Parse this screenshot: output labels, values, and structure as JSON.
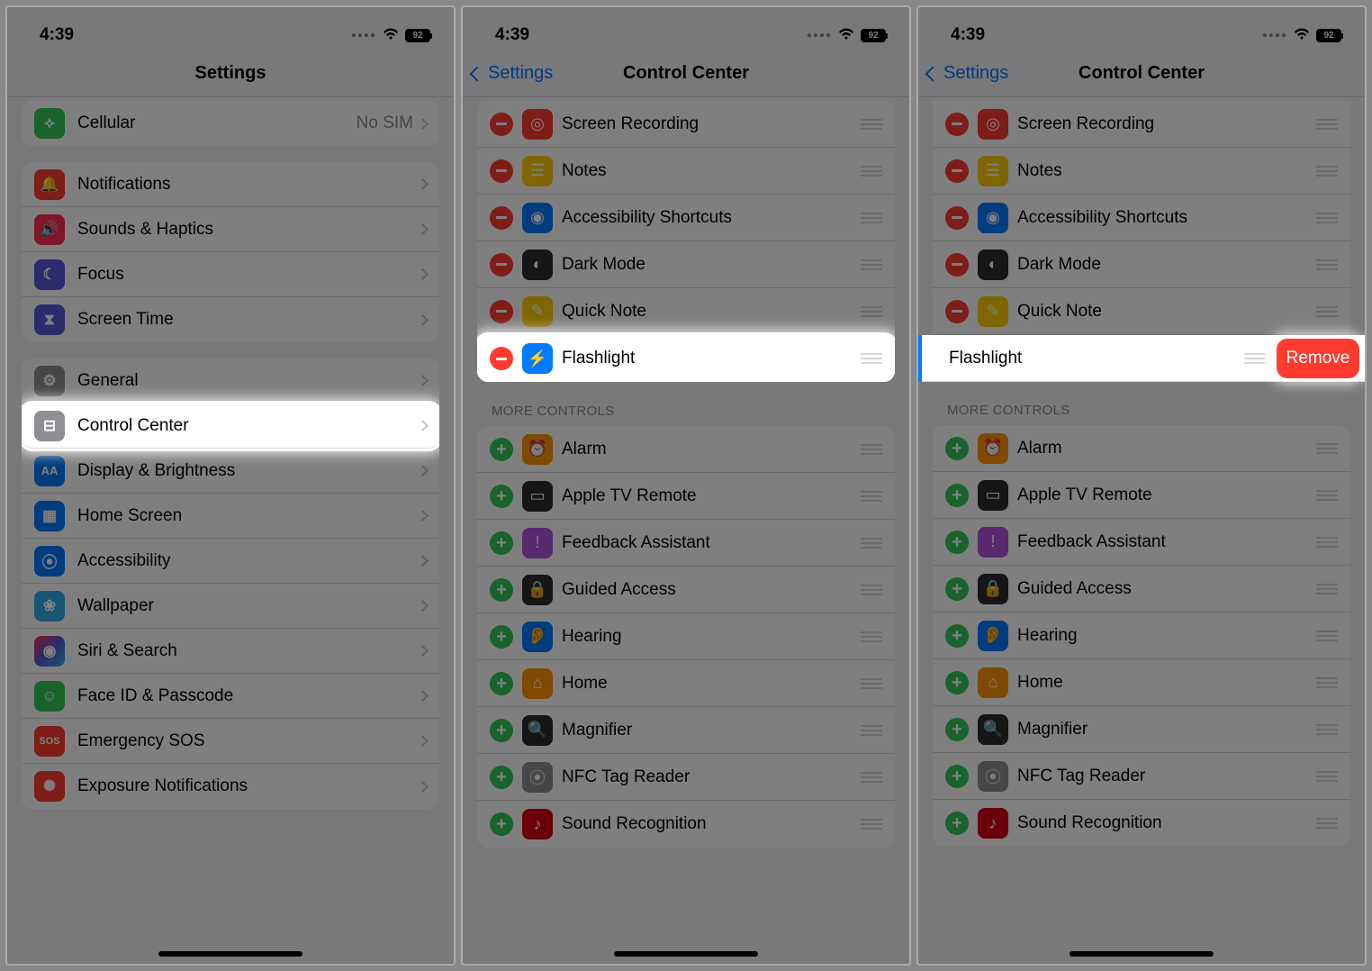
{
  "status": {
    "time": "4:39",
    "battery": "92"
  },
  "screen1": {
    "title": "Settings",
    "cellular": {
      "label": "Cellular",
      "detail": "No SIM"
    },
    "group_notifications": [
      {
        "label": "Notifications",
        "icon": "bell-icon",
        "color": "bg-red"
      },
      {
        "label": "Sounds & Haptics",
        "icon": "speaker-icon",
        "color": "bg-red2"
      },
      {
        "label": "Focus",
        "icon": "moon-icon",
        "color": "bg-indigo"
      },
      {
        "label": "Screen Time",
        "icon": "hourglass-icon",
        "color": "bg-indigo"
      }
    ],
    "group_general": [
      {
        "label": "General",
        "icon": "gear-icon",
        "color": "bg-gray"
      },
      {
        "label": "Control Center",
        "icon": "switches-icon",
        "color": "bg-gray",
        "highlight": true
      },
      {
        "label": "Display & Brightness",
        "icon": "aa-icon",
        "color": "bg-blue"
      },
      {
        "label": "Home Screen",
        "icon": "grid-icon",
        "color": "bg-blue"
      },
      {
        "label": "Accessibility",
        "icon": "person-icon",
        "color": "bg-blue"
      },
      {
        "label": "Wallpaper",
        "icon": "flower-icon",
        "color": "bg-cyan"
      },
      {
        "label": "Siri & Search",
        "icon": "siri-icon",
        "color": "bg-siri"
      },
      {
        "label": "Face ID & Passcode",
        "icon": "face-icon",
        "color": "bg-green"
      },
      {
        "label": "Emergency SOS",
        "icon": "sos-icon",
        "color": "bg-red"
      },
      {
        "label": "Exposure Notifications",
        "icon": "virus-icon",
        "color": "bg-red"
      }
    ]
  },
  "screen2": {
    "back": "Settings",
    "title": "Control Center",
    "included": [
      {
        "label": "Screen Recording",
        "icon": "record-icon",
        "color": "bg-red"
      },
      {
        "label": "Notes",
        "icon": "notes-icon",
        "color": "bg-yellow"
      },
      {
        "label": "Accessibility Shortcuts",
        "icon": "access-icon",
        "color": "bg-blue"
      },
      {
        "label": "Dark Mode",
        "icon": "dark-icon",
        "color": "bg-dark"
      },
      {
        "label": "Quick Note",
        "icon": "qnote-icon",
        "color": "bg-yellow"
      },
      {
        "label": "Flashlight",
        "icon": "flash-icon",
        "color": "bg-blue",
        "highlight": true
      }
    ],
    "more_header": "More Controls",
    "more": [
      {
        "label": "Alarm",
        "icon": "alarm-icon",
        "color": "bg-orange"
      },
      {
        "label": "Apple TV Remote",
        "icon": "remote-icon",
        "color": "bg-dark"
      },
      {
        "label": "Feedback Assistant",
        "icon": "feedback-icon",
        "color": "bg-purple"
      },
      {
        "label": "Guided Access",
        "icon": "lock-icon",
        "color": "bg-dark"
      },
      {
        "label": "Hearing",
        "icon": "ear-icon",
        "color": "bg-blue"
      },
      {
        "label": "Home",
        "icon": "home-icon",
        "color": "bg-orange"
      },
      {
        "label": "Magnifier",
        "icon": "mag-icon",
        "color": "bg-dark"
      },
      {
        "label": "NFC Tag Reader",
        "icon": "nfc-icon",
        "color": "bg-gray"
      },
      {
        "label": "Sound Recognition",
        "icon": "sound-icon",
        "color": "bg-dred"
      }
    ]
  },
  "screen3": {
    "back": "Settings",
    "title": "Control Center",
    "included": [
      {
        "label": "Screen Recording",
        "icon": "record-icon",
        "color": "bg-red"
      },
      {
        "label": "Notes",
        "icon": "notes-icon",
        "color": "bg-yellow"
      },
      {
        "label": "Accessibility Shortcuts",
        "icon": "access-icon",
        "color": "bg-blue"
      },
      {
        "label": "Dark Mode",
        "icon": "dark-icon",
        "color": "bg-dark"
      },
      {
        "label": "Quick Note",
        "icon": "qnote-icon",
        "color": "bg-yellow"
      }
    ],
    "slide_item": {
      "label": "Flashlight",
      "remove": "Remove"
    },
    "more_header": "More Controls",
    "more": [
      {
        "label": "Alarm",
        "icon": "alarm-icon",
        "color": "bg-orange"
      },
      {
        "label": "Apple TV Remote",
        "icon": "remote-icon",
        "color": "bg-dark"
      },
      {
        "label": "Feedback Assistant",
        "icon": "feedback-icon",
        "color": "bg-purple"
      },
      {
        "label": "Guided Access",
        "icon": "lock-icon",
        "color": "bg-dark"
      },
      {
        "label": "Hearing",
        "icon": "ear-icon",
        "color": "bg-blue"
      },
      {
        "label": "Home",
        "icon": "home-icon",
        "color": "bg-orange"
      },
      {
        "label": "Magnifier",
        "icon": "mag-icon",
        "color": "bg-dark"
      },
      {
        "label": "NFC Tag Reader",
        "icon": "nfc-icon",
        "color": "bg-gray"
      },
      {
        "label": "Sound Recognition",
        "icon": "sound-icon",
        "color": "bg-dred"
      }
    ]
  },
  "icon_glyphs": {
    "bell-icon": "🔔",
    "speaker-icon": "🔊",
    "moon-icon": "☾",
    "hourglass-icon": "⧗",
    "gear-icon": "⚙",
    "switches-icon": "⊟",
    "aa-icon": "AA",
    "grid-icon": "▦",
    "person-icon": "⦿",
    "flower-icon": "❀",
    "siri-icon": "◉",
    "face-icon": "☺",
    "sos-icon": "SOS",
    "virus-icon": "✺",
    "antenna-icon": "⟡",
    "record-icon": "◎",
    "notes-icon": "☰",
    "access-icon": "◉",
    "dark-icon": "◐",
    "qnote-icon": "✎",
    "flash-icon": "⚡",
    "alarm-icon": "⏰",
    "remote-icon": "▭",
    "feedback-icon": "!",
    "lock-icon": "🔒",
    "ear-icon": "👂",
    "home-icon": "⌂",
    "mag-icon": "🔍",
    "nfc-icon": "⦿",
    "sound-icon": "♪"
  }
}
